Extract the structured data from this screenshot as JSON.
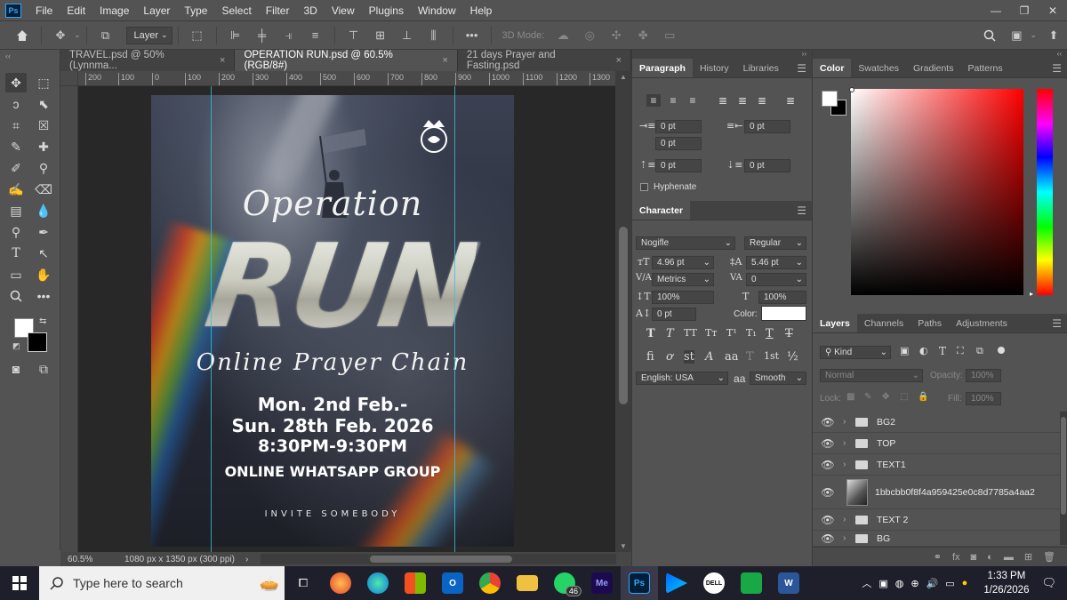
{
  "app": {
    "logo": "Ps"
  },
  "menu": [
    "File",
    "Edit",
    "Image",
    "Layer",
    "Type",
    "Select",
    "Filter",
    "3D",
    "View",
    "Plugins",
    "Window",
    "Help"
  ],
  "window_controls": {
    "minimize": "—",
    "restore": "❐",
    "close": "✕"
  },
  "options_bar": {
    "layer_select": "Layer",
    "mode_3d": "3D Mode:"
  },
  "tabs": [
    {
      "label": "TRAVEL.psd @ 50% (Lynnma...",
      "close": "×"
    },
    {
      "label": "OPERATION RUN.psd @ 60.5% (RGB/8#)",
      "close": "×",
      "active": true
    },
    {
      "label": "21 days Prayer and Fasting.psd",
      "close": "×"
    }
  ],
  "ruler": {
    "h": [
      "200",
      "100",
      "0",
      "100",
      "200",
      "300",
      "400",
      "500",
      "600",
      "700",
      "800",
      "900",
      "1000",
      "1100",
      "1200",
      "1300"
    ]
  },
  "artwork": {
    "title": "Operation",
    "big_word": "RUN",
    "script": "Online Prayer Chain",
    "date_line1": "Mon. 2nd Feb.-",
    "date_line2": "Sun. 28th Feb. 2026",
    "time": "8:30PM-9:30PM",
    "group": "ONLINE WHATSAPP GROUP",
    "invite": "INVITE SOMEBODY"
  },
  "status": {
    "zoom": "60.5%",
    "doc_size": "1080 px x 1350 px (300 ppi)",
    "arrow": "›"
  },
  "paragraph_panel": {
    "tabs": [
      "Paragraph",
      "History",
      "Libraries"
    ],
    "indent_left": "0 pt",
    "indent_right": "0 pt",
    "first_line": "0 pt",
    "space_before": "0 pt",
    "space_after": "0 pt",
    "hyphenate": "Hyphenate"
  },
  "character_panel": {
    "title": "Character",
    "font": "Nogifle",
    "style": "Regular",
    "size": "4.96 pt",
    "leading": "5.46 pt",
    "kerning": "Metrics",
    "tracking": "0",
    "vscale": "100%",
    "hscale": "100%",
    "baseline": "0 pt",
    "color_label": "Color:",
    "language": "English: USA",
    "aa_label": "a",
    "antialias": "Smooth"
  },
  "color_panel": {
    "tabs": [
      "Color",
      "Swatches",
      "Gradients",
      "Patterns"
    ],
    "fg_color": "#ffffff",
    "bg_color": "#000000"
  },
  "layers_panel": {
    "tabs": [
      "Layers",
      "Channels",
      "Paths",
      "Adjustments"
    ],
    "filter_kind": "Kind",
    "blend": "Normal",
    "opacity_label": "Opacity:",
    "opacity": "100%",
    "lock_label": "Lock:",
    "fill_label": "Fill:",
    "fill": "100%",
    "layers": [
      {
        "name": "BG2",
        "type": "group"
      },
      {
        "name": "TOP",
        "type": "group"
      },
      {
        "name": "TEXT1",
        "type": "group"
      },
      {
        "name": "1bbcbb0f8f4a959425e0c8d7785a4aa2",
        "type": "image"
      },
      {
        "name": "TEXT 2",
        "type": "group"
      },
      {
        "name": "BG",
        "type": "group"
      }
    ]
  },
  "taskbar": {
    "search_placeholder": "Type here to search",
    "whatsapp_badge": "46",
    "me_label": "Me",
    "ps_label": "Ps",
    "dell_label": "DELL",
    "word_label": "W",
    "time": "1:33 PM",
    "date": "1/26/2026"
  }
}
